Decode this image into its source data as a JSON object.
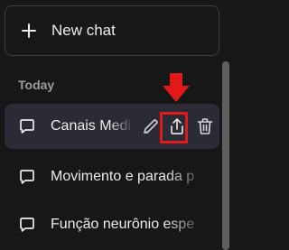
{
  "new_chat": {
    "label": "New chat",
    "icon": "plus-icon"
  },
  "history": {
    "section_label": "Today",
    "items": [
      {
        "title": "Canais Medi",
        "icon": "chat-bubble-icon",
        "active": true
      },
      {
        "title": "Movimento e parada p",
        "icon": "chat-bubble-icon",
        "active": false
      },
      {
        "title": "Função neurônio espe",
        "icon": "chat-bubble-icon",
        "active": false
      }
    ],
    "active_actions": [
      "pencil-icon",
      "share-icon",
      "trash-icon"
    ]
  },
  "annotation": {
    "color": "#e11919",
    "arrow_icon": "arrow-down-icon"
  },
  "colors": {
    "background": "#171717",
    "active_item": "#2b2b36",
    "text": "#ececec",
    "muted_text": "#9b9b9b"
  }
}
